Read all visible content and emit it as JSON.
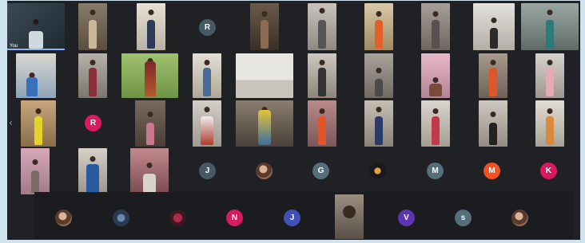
{
  "self_tile": {
    "label": "You"
  },
  "nav": {
    "prev": "‹"
  },
  "avatars": {
    "r1": "R",
    "r2": "R",
    "j1": "J",
    "g": "G",
    "m1": "M",
    "m2": "M",
    "k": "K",
    "n": "N",
    "j2": "J",
    "v": "V",
    "s": "s"
  },
  "colors": {
    "background": "#202124",
    "accent_blue": "#8ab4f8",
    "avatar_r_teal": "#455a64",
    "avatar_red": "#d81b60",
    "avatar_orange": "#f4511e",
    "avatar_purple": "#5e35b1",
    "avatar_indigo": "#3f51b5",
    "avatar_grey": "#546e7a"
  }
}
